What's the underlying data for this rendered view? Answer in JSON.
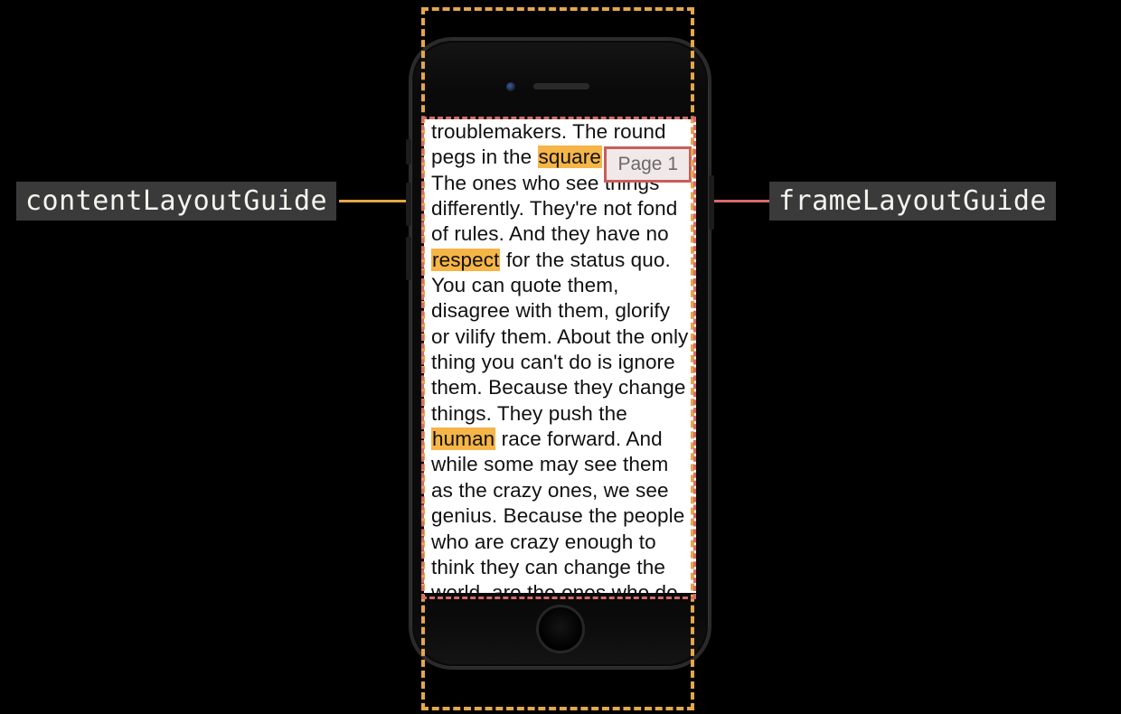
{
  "labels": {
    "contentLayoutGuide": "contentLayoutGuide",
    "frameLayoutGuide": "frameLayoutGuide"
  },
  "page_badge": "Page 1",
  "guides": {
    "content_color": "#e5a74a",
    "frame_color": "#d86a6a"
  },
  "text_segments": [
    {
      "t": "troublemakers. The round pegs in the "
    },
    {
      "t": "square",
      "hl": true
    },
    {
      "t": " holes. The ones who see things differently. They're not fond of rules. And they have no "
    },
    {
      "t": "respect",
      "hl": true
    },
    {
      "t": " for the status quo. You can quote them, disagree with them, glorify or vilify them. About the only thing you can't do is ignore them. Because they change things. They push the "
    },
    {
      "t": "human",
      "hl": true
    },
    {
      "t": " race forward. And while some may see them as the crazy ones, we see genius. Because the people who are crazy enough to think they can change the world, are the ones who do."
    }
  ]
}
